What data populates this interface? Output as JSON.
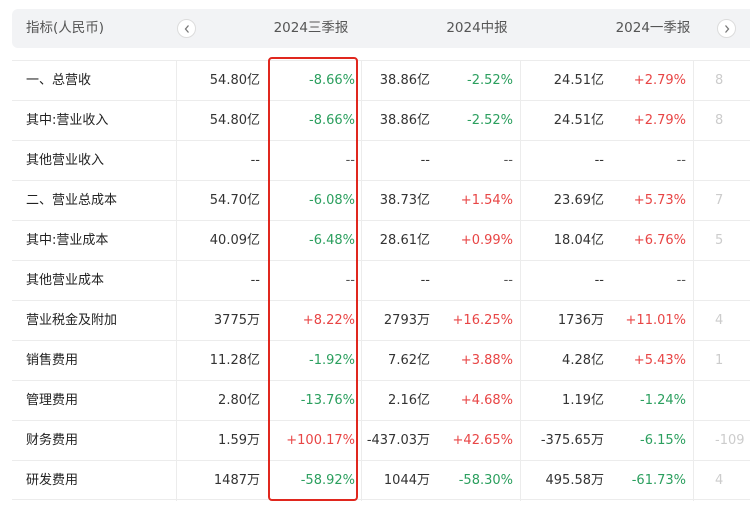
{
  "header": {
    "title": "指标(人民币)",
    "periods": [
      "2024三季报",
      "2024中报",
      "2024一季报"
    ]
  },
  "colors": {
    "up": "#e84545",
    "down": "#2b9f5e",
    "highlight": "#e0271e"
  },
  "rows": [
    {
      "label": "一、总营收",
      "v1": "54.80亿",
      "g1": "-8.66%",
      "v2": "38.86亿",
      "g2": "-2.52%",
      "v3": "24.51亿",
      "g3": "+2.79%",
      "v4": "8"
    },
    {
      "label": "其中:营业收入",
      "v1": "54.80亿",
      "g1": "-8.66%",
      "v2": "38.86亿",
      "g2": "-2.52%",
      "v3": "24.51亿",
      "g3": "+2.79%",
      "v4": "8"
    },
    {
      "label": "其他营业收入",
      "v1": "--",
      "g1": "--",
      "v2": "--",
      "g2": "--",
      "v3": "--",
      "g3": "--",
      "v4": ""
    },
    {
      "label": "二、营业总成本",
      "v1": "54.70亿",
      "g1": "-6.08%",
      "v2": "38.73亿",
      "g2": "+1.54%",
      "v3": "23.69亿",
      "g3": "+5.73%",
      "v4": "7"
    },
    {
      "label": "其中:营业成本",
      "v1": "40.09亿",
      "g1": "-6.48%",
      "v2": "28.61亿",
      "g2": "+0.99%",
      "v3": "18.04亿",
      "g3": "+6.76%",
      "v4": "5"
    },
    {
      "label": "其他营业成本",
      "v1": "--",
      "g1": "--",
      "v2": "--",
      "g2": "--",
      "v3": "--",
      "g3": "--",
      "v4": ""
    },
    {
      "label": "营业税金及附加",
      "v1": "3775万",
      "g1": "+8.22%",
      "v2": "2793万",
      "g2": "+16.25%",
      "v3": "1736万",
      "g3": "+11.01%",
      "v4": "4"
    },
    {
      "label": "销售费用",
      "v1": "11.28亿",
      "g1": "-1.92%",
      "v2": "7.62亿",
      "g2": "+3.88%",
      "v3": "4.28亿",
      "g3": "+5.43%",
      "v4": "1"
    },
    {
      "label": "管理费用",
      "v1": "2.80亿",
      "g1": "-13.76%",
      "v2": "2.16亿",
      "g2": "+4.68%",
      "v3": "1.19亿",
      "g3": "-1.24%",
      "v4": ""
    },
    {
      "label": "财务费用",
      "v1": "1.59万",
      "g1": "+100.17%",
      "v2": "-437.03万",
      "g2": "+42.65%",
      "v3": "-375.65万",
      "g3": "-6.15%",
      "v4": "-109"
    },
    {
      "label": "研发费用",
      "v1": "1487万",
      "g1": "-58.92%",
      "v2": "1044万",
      "g2": "-58.30%",
      "v3": "495.58万",
      "g3": "-61.73%",
      "v4": "4"
    }
  ]
}
